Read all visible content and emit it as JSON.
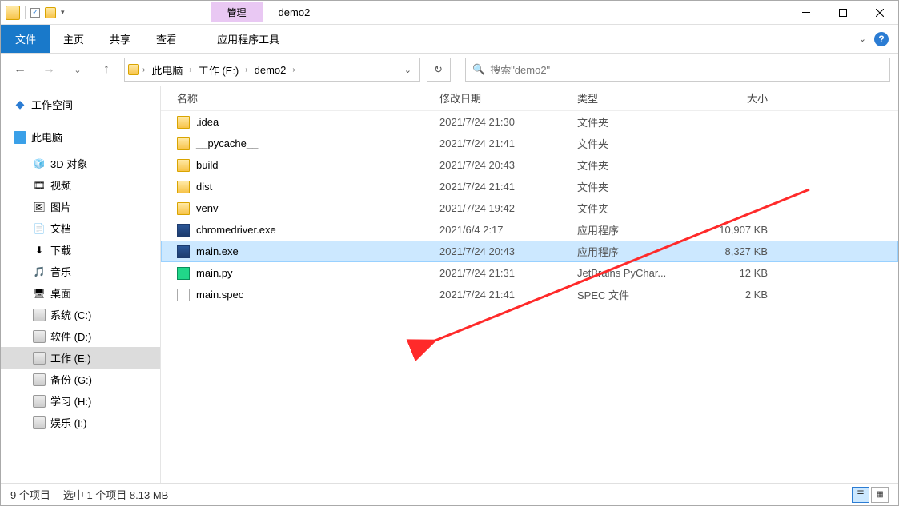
{
  "title": "demo2",
  "context_tab": "管理",
  "ribbon": {
    "file": "文件",
    "tabs": [
      "主页",
      "共享",
      "查看"
    ],
    "ctx_tab": "应用程序工具"
  },
  "breadcrumb": [
    "此电脑",
    "工作 (E:)",
    "demo2"
  ],
  "search_placeholder": "搜索\"demo2\"",
  "sidebar": {
    "workspace": "工作空间",
    "this_pc": "此电脑",
    "items": [
      {
        "label": "3D 对象",
        "icon": "cube"
      },
      {
        "label": "视频",
        "icon": "video"
      },
      {
        "label": "图片",
        "icon": "picture"
      },
      {
        "label": "文档",
        "icon": "doc"
      },
      {
        "label": "下载",
        "icon": "download"
      },
      {
        "label": "音乐",
        "icon": "music"
      },
      {
        "label": "桌面",
        "icon": "desktop"
      },
      {
        "label": "系统 (C:)",
        "icon": "drive"
      },
      {
        "label": "软件 (D:)",
        "icon": "drive"
      },
      {
        "label": "工作 (E:)",
        "icon": "drive",
        "selected": true
      },
      {
        "label": "备份 (G:)",
        "icon": "drive"
      },
      {
        "label": "学习 (H:)",
        "icon": "drive"
      },
      {
        "label": "娱乐 (I:)",
        "icon": "drive"
      }
    ]
  },
  "columns": {
    "name": "名称",
    "date": "修改日期",
    "type": "类型",
    "size": "大小"
  },
  "files": [
    {
      "name": ".idea",
      "date": "2021/7/24 21:30",
      "type": "文件夹",
      "size": "",
      "icon": "folder"
    },
    {
      "name": "__pycache__",
      "date": "2021/7/24 21:41",
      "type": "文件夹",
      "size": "",
      "icon": "folder"
    },
    {
      "name": "build",
      "date": "2021/7/24 20:43",
      "type": "文件夹",
      "size": "",
      "icon": "folder"
    },
    {
      "name": "dist",
      "date": "2021/7/24 21:41",
      "type": "文件夹",
      "size": "",
      "icon": "folder"
    },
    {
      "name": "venv",
      "date": "2021/7/24 19:42",
      "type": "文件夹",
      "size": "",
      "icon": "folder"
    },
    {
      "name": "chromedriver.exe",
      "date": "2021/6/4 2:17",
      "type": "应用程序",
      "size": "10,907 KB",
      "icon": "exe"
    },
    {
      "name": "main.exe",
      "date": "2021/7/24 20:43",
      "type": "应用程序",
      "size": "8,327 KB",
      "icon": "exe",
      "selected": true
    },
    {
      "name": "main.py",
      "date": "2021/7/24 21:31",
      "type": "JetBrains PyChar...",
      "size": "12 KB",
      "icon": "py"
    },
    {
      "name": "main.spec",
      "date": "2021/7/24 21:41",
      "type": "SPEC 文件",
      "size": "2 KB",
      "icon": "file"
    }
  ],
  "status": {
    "items": "9 个项目",
    "selected": "选中 1 个项目 8.13 MB"
  }
}
